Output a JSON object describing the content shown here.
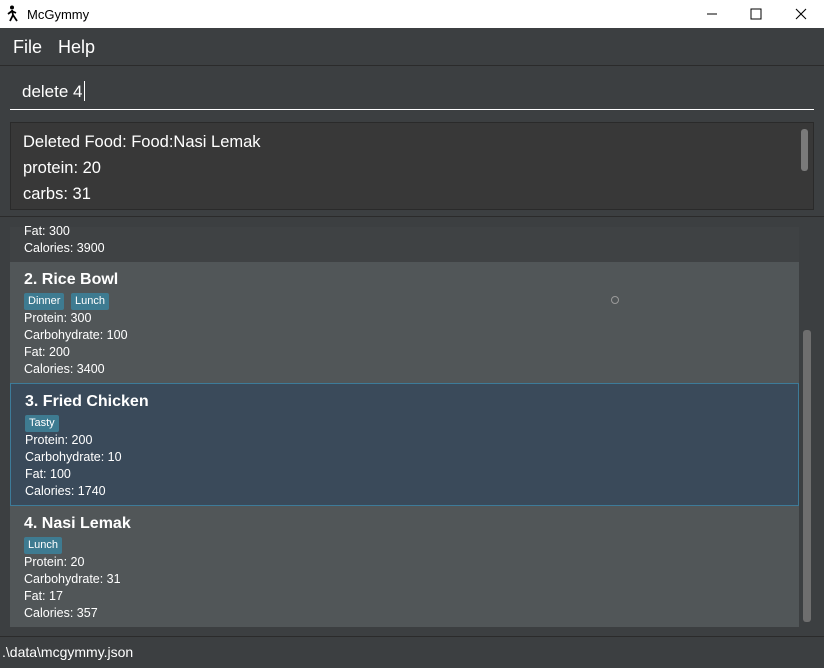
{
  "window": {
    "title": "McGymmy"
  },
  "menu": {
    "file": "File",
    "help": "Help"
  },
  "command": {
    "value": "delete 4"
  },
  "result": {
    "lines": [
      "Deleted Food: Food:Nasi Lemak",
      "protein: 20",
      "carbs: 31"
    ]
  },
  "list": {
    "partial_item": {
      "fat": "Fat: 300",
      "calories": "Calories: 3900"
    },
    "items": [
      {
        "name": "2.  Rice Bowl",
        "tags": [
          "Dinner",
          "Lunch"
        ],
        "protein": "Protein: 300",
        "carbs": "Carbohydrate: 100",
        "fat": "Fat: 200",
        "calories": "Calories: 3400"
      },
      {
        "name": "3.  Fried Chicken",
        "tags": [
          "Tasty"
        ],
        "protein": "Protein: 200",
        "carbs": "Carbohydrate: 10",
        "fat": "Fat: 100",
        "calories": "Calories: 1740"
      },
      {
        "name": "4.  Nasi Lemak",
        "tags": [
          "Lunch"
        ],
        "protein": "Protein: 20",
        "carbs": "Carbohydrate: 31",
        "fat": "Fat: 17",
        "calories": "Calories: 357"
      }
    ]
  },
  "status": {
    "path": ".\\data\\mcgymmy.json"
  },
  "icons": {
    "app": "stick-figure-icon",
    "minimize": "minimize-icon",
    "maximize": "maximize-icon",
    "close": "close-icon"
  },
  "colors": {
    "background": "#3c3f41",
    "card": "#515658",
    "selected_card": "#3a4a5a",
    "tag": "#3e7b91"
  }
}
